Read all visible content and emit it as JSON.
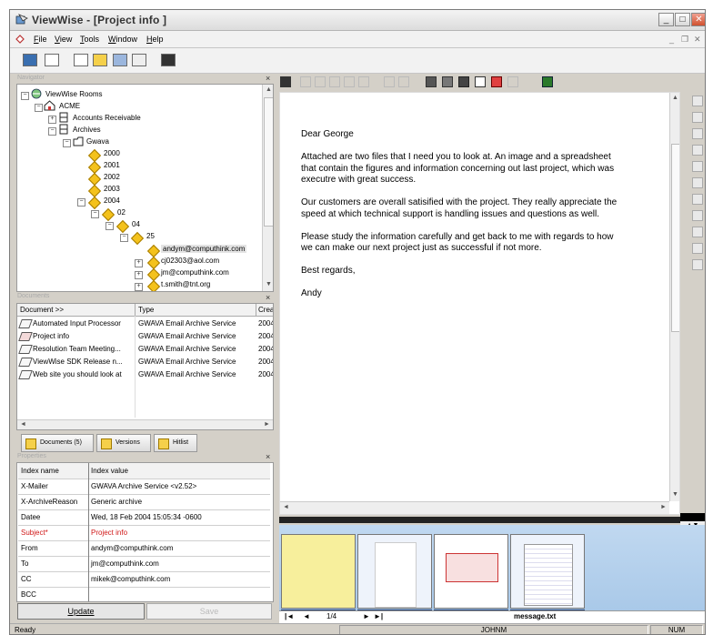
{
  "window": {
    "title": "ViewWise - [Project info ]",
    "controls": {
      "minimize": "_",
      "restore": "□",
      "close": "✕"
    },
    "mdi_controls": {
      "minimize": "_",
      "restore": "❐",
      "close": "✕"
    }
  },
  "menu": [
    "File",
    "View",
    "Tools",
    "Window",
    "Help"
  ],
  "navigator": {
    "header": "Navigator",
    "close": "×",
    "nodes": [
      {
        "label": "ViewWise Rooms",
        "icon": "rooms-icon"
      },
      {
        "label": "ACME",
        "icon": "home-icon"
      },
      {
        "label": "Accounts Receivable",
        "icon": "cabinet-icon"
      },
      {
        "label": "Archives",
        "icon": "cabinet-icon"
      },
      {
        "label": "Gwava",
        "icon": "folder-icon"
      },
      {
        "label": "2000",
        "icon": "diamond-icon"
      },
      {
        "label": "2001",
        "icon": "diamond-icon"
      },
      {
        "label": "2002",
        "icon": "diamond-icon"
      },
      {
        "label": "2003",
        "icon": "diamond-icon"
      },
      {
        "label": "2004",
        "icon": "diamond-icon"
      },
      {
        "label": "02",
        "icon": "diamond-icon"
      },
      {
        "label": "04",
        "icon": "diamond-icon"
      },
      {
        "label": "25",
        "icon": "diamond-icon"
      },
      {
        "label": "andym@computhink.com",
        "icon": "diamond-icon"
      },
      {
        "label": "cj02303@aol.com",
        "icon": "diamond-icon"
      },
      {
        "label": "jm@computhink.com",
        "icon": "diamond-icon"
      },
      {
        "label": "t.smith@tnt.org",
        "icon": "diamond-icon"
      }
    ]
  },
  "documents": {
    "header": "Documents",
    "close": "×",
    "columns": [
      "Document >>",
      "Type",
      "Crea"
    ],
    "rows": [
      {
        "name": "Automated Input Processor",
        "type": "GWAVA Email Archive Service",
        "created": "2004"
      },
      {
        "name": "Project info",
        "type": "GWAVA Email Archive Service",
        "created": "2004"
      },
      {
        "name": "Resolution Team Meeting...",
        "type": "GWAVA Email Archive Service",
        "created": "2004"
      },
      {
        "name": "ViewWise SDK Release n...",
        "type": "GWAVA Email Archive Service",
        "created": "2004"
      },
      {
        "name": "Web site you should look at",
        "type": "GWAVA Email Archive Service",
        "created": "2004"
      }
    ],
    "tabs": [
      "Documents (5)",
      "Versions",
      "Hitlist"
    ]
  },
  "properties": {
    "header": "Properties",
    "close": "×",
    "columns": [
      "Index name",
      "Index value"
    ],
    "rows": [
      {
        "key": "X-Mailer",
        "value": "GWAVA Archive Service <v2.52>"
      },
      {
        "key": "X-ArchiveReason",
        "value": "Generic archive"
      },
      {
        "key": "Datee",
        "value": "Wed, 18 Feb 2004 15:05:34 -0600"
      },
      {
        "key": "Subject*",
        "value": "Project info"
      },
      {
        "key": "From",
        "value": "andym@computhink.com"
      },
      {
        "key": "To",
        "value": "jm@computhink.com"
      },
      {
        "key": "CC",
        "value": "mikek@computhink.com"
      },
      {
        "key": "BCC",
        "value": ""
      }
    ],
    "update_label": "Update",
    "save_label": "Save"
  },
  "viewer": {
    "letter": [
      "Dear George",
      "Attached are two files that I need you to look at.  An image and a spreadsheet that contain the figures and information concerning out last project, which was executre with great success.",
      "Our customers are overall satisified with the project.  They really appreciate the speed at which technical support is handling issues and questions as well.",
      "Please study the information carefully and get back to me with regards to how we can make our next project just as successful if not more.",
      "Best regards,",
      "Andy"
    ]
  },
  "thumbnails": {
    "pages": [
      "1",
      "2",
      "3",
      "4"
    ],
    "page_indicator": "1/4",
    "filename": "message.txt"
  },
  "status": {
    "left": "Ready",
    "user": "JOHNM",
    "num": "NUM"
  },
  "colors": {
    "subject_red": "#d01818",
    "thumb_bar": "#1f3868",
    "diamond": "#f4c21c"
  }
}
